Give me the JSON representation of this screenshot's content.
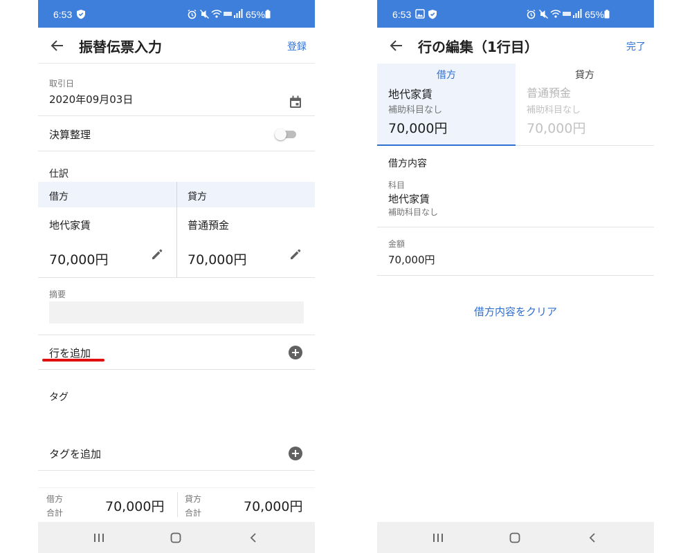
{
  "left": {
    "status": {
      "time": "6:53",
      "battery": "65%"
    },
    "appbar": {
      "title": "振替伝票入力",
      "action": "登録"
    },
    "trade_date": {
      "label": "取引日",
      "value": "2020年09月03日"
    },
    "settlement": {
      "label": "決算整理",
      "enabled": false
    },
    "journal": {
      "label": "仕訳",
      "debit": {
        "header": "借方",
        "account": "地代家賃",
        "amount": "70,000円"
      },
      "credit": {
        "header": "貸方",
        "account": "普通預金",
        "amount": "70,000円"
      }
    },
    "memo": {
      "label": "摘要",
      "value": ""
    },
    "add_row": {
      "label": "行を追加"
    },
    "tags": {
      "label": "タグ",
      "add_label": "タグを追加"
    },
    "totals": {
      "debit_label_1": "借方",
      "debit_label_2": "合計",
      "debit_value": "70,000円",
      "credit_label_1": "貸方",
      "credit_label_2": "合計",
      "credit_value": "70,000円"
    }
  },
  "right": {
    "status": {
      "time": "6:53",
      "battery": "65%"
    },
    "appbar": {
      "title": "行の編集（1行目）",
      "action": "完了"
    },
    "tabs": {
      "debit": {
        "header": "借方",
        "account": "地代家賃",
        "sub": "補助科目なし",
        "amount": "70,000円"
      },
      "credit": {
        "header": "貸方",
        "account": "普通預金",
        "sub": "補助科目なし",
        "amount": "70,000円"
      }
    },
    "detail": {
      "section": "借方内容",
      "account_label": "科目",
      "account_value": "地代家賃",
      "sub_value": "補助科目なし",
      "amount_label": "金額",
      "amount_value": "70,000円",
      "clear_label": "借方内容をクリア"
    }
  },
  "colors": {
    "status_bar": "#3f7fdc",
    "accent": "#2d6fd2",
    "highlight_bg": "#eef3fc",
    "annotation": "#e01010"
  },
  "icons": [
    "back-arrow-icon",
    "calendar-icon",
    "pencil-icon",
    "plus-circle-icon",
    "recent-apps-icon",
    "home-icon",
    "back-nav-icon",
    "shield-icon",
    "image-icon",
    "alarm-icon",
    "mute-icon",
    "wifi-icon",
    "signal-icon",
    "battery-icon"
  ]
}
